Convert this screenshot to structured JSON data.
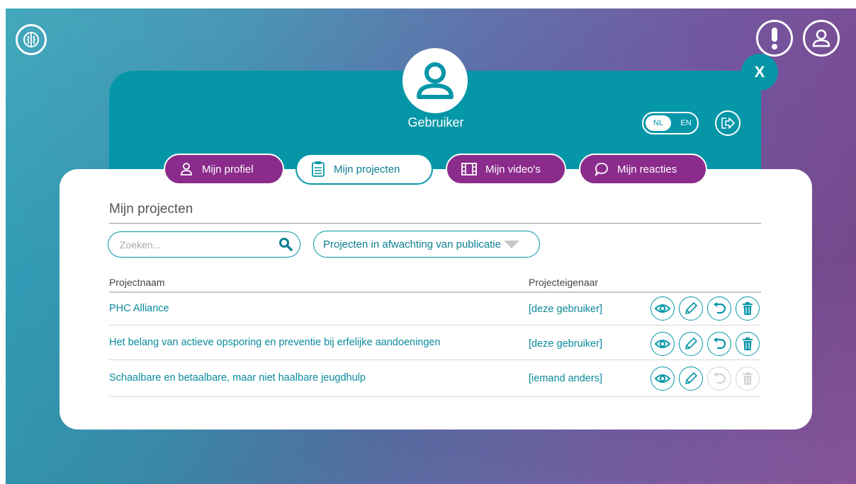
{
  "header": {
    "close_label": "X"
  },
  "user": {
    "name": "Gebruiker"
  },
  "language": {
    "nl": "NL",
    "en": "EN"
  },
  "tabs": [
    {
      "label": "Mijn profiel",
      "icon": "person-icon"
    },
    {
      "label": "Mijn projecten",
      "icon": "clipboard-icon"
    },
    {
      "label": "Mijn video's",
      "icon": "film-icon"
    },
    {
      "label": "Mijn reacties",
      "icon": "speech-bubble-icon"
    }
  ],
  "main": {
    "heading": "Mijn projecten",
    "search_placeholder": "Zoeken...",
    "filter_label": "Projecten in afwachting van publicatie",
    "columns": {
      "name": "Projectnaam",
      "owner": "Projecteigenaar"
    },
    "rows": [
      {
        "name": "PHC Alliance",
        "owner": "[deze gebruiker]",
        "undo_enabled": true,
        "delete_enabled": true
      },
      {
        "name": "Het belang van actieve opsporing en preventie bij erfelijke aandoeningen",
        "owner": "[deze gebruiker]",
        "undo_enabled": true,
        "delete_enabled": true
      },
      {
        "name": "Schaalbare en betaalbare, maar niet haalbare jeugdhulp",
        "owner": "[iemand anders]",
        "undo_enabled": false,
        "delete_enabled": false
      }
    ]
  },
  "colors": {
    "teal": "#0596a8",
    "purple": "#8b2c8c",
    "disabled": "#d4d4d4"
  }
}
